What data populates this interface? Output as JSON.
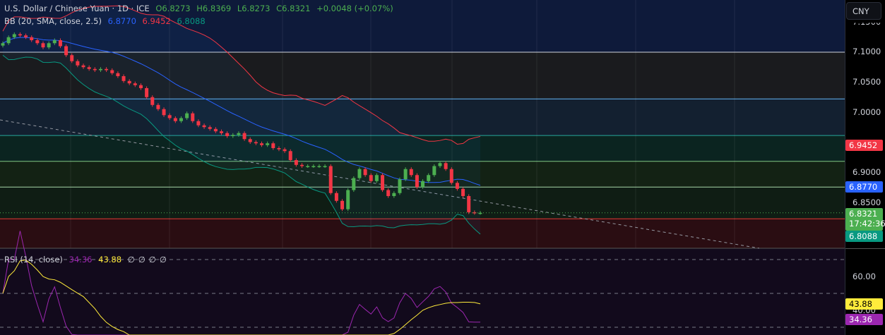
{
  "header": {
    "symbol": "U.S. Dollar / Chinese Yuan · 1D · ICE",
    "open": "O6.8273",
    "high": "H6.8369",
    "low": "L6.8273",
    "close": "C6.8321",
    "change": "+0.0048 (+0.07%)"
  },
  "bb": {
    "label": "BB (20, SMA, close, 2.5)",
    "basis": "6.8770",
    "upper": "6.9452",
    "lower": "6.8088"
  },
  "rsi": {
    "label": "RSI (14, close)",
    "value": "34.36",
    "ma": "43.88",
    "extras": [
      "∅",
      "∅",
      "∅",
      "∅"
    ]
  },
  "currency_button": "CNY",
  "price_axis": {
    "ticks": [
      "7.1000",
      "7.0500",
      "7.0000",
      "6.9000",
      "6.8500"
    ],
    "partial_top": "7.1500",
    "tags": {
      "upper": "6.9452",
      "basis": "6.8770",
      "last": "6.8321",
      "countdown": "17:42:36",
      "lower": "6.8088"
    }
  },
  "rsi_axis": {
    "ticks": [
      "60.00",
      "40.00"
    ],
    "tags": {
      "ma": "43.88",
      "rsi": "34.36"
    }
  },
  "colors": {
    "up": "#4caf50",
    "down": "#f23645",
    "basis": "#2962ff",
    "upper": "#f23645",
    "lower": "#089981",
    "rsi": "#9c27b0",
    "rsi_ma": "#ffeb3b"
  },
  "chart_data": {
    "type": "candlestick",
    "ylim": [
      6.78,
      7.17
    ],
    "levels": [
      7.1,
      7.022,
      6.961,
      6.918,
      6.875,
      6.822
    ],
    "closes": [
      7.115,
      7.125,
      7.13,
      7.128,
      7.125,
      7.12,
      7.115,
      7.108,
      7.115,
      7.12,
      7.11,
      7.095,
      7.085,
      7.078,
      7.075,
      7.072,
      7.07,
      7.072,
      7.07,
      7.065,
      7.06,
      7.052,
      7.048,
      7.045,
      7.04,
      7.025,
      7.012,
      7.005,
      6.995,
      6.99,
      6.985,
      6.99,
      6.998,
      6.985,
      6.978,
      6.975,
      6.972,
      6.968,
      6.965,
      6.96,
      6.962,
      6.965,
      6.955,
      6.95,
      6.948,
      6.945,
      6.948,
      6.94,
      6.938,
      6.935,
      6.92,
      6.912,
      6.91,
      6.91,
      6.91,
      6.91,
      6.91,
      6.865,
      6.852,
      6.838,
      6.87,
      6.89,
      6.905,
      6.895,
      6.885,
      6.895,
      6.87,
      6.86,
      6.865,
      6.888,
      6.905,
      6.895,
      6.875,
      6.885,
      6.895,
      6.91,
      6.915,
      6.905,
      6.882,
      6.872,
      6.86,
      6.833,
      6.832,
      6.832
    ]
  }
}
